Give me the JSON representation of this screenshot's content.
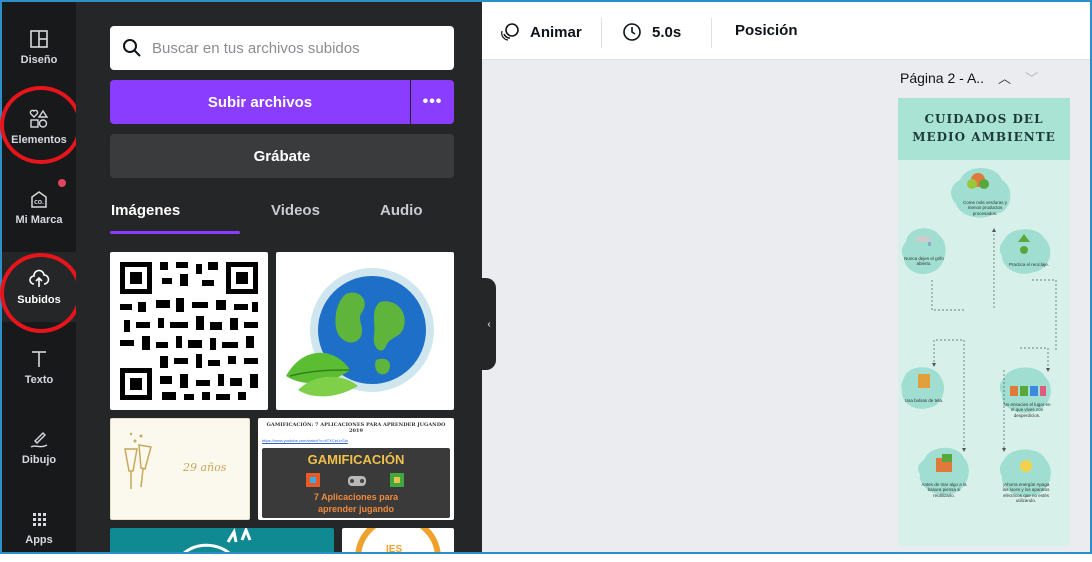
{
  "rail": {
    "items": [
      {
        "label": "Diseño",
        "icon": "layout-icon"
      },
      {
        "label": "Elementos",
        "icon": "shapes-icon"
      },
      {
        "label": "Mi Marca",
        "icon": "brand-kit-icon"
      },
      {
        "label": "Subidos",
        "icon": "upload-cloud-icon"
      },
      {
        "label": "Texto",
        "icon": "text-icon"
      },
      {
        "label": "Dibujo",
        "icon": "draw-icon"
      },
      {
        "label": "Apps",
        "icon": "apps-grid-icon"
      }
    ]
  },
  "panel": {
    "search_placeholder": "Buscar en tus archivos subidos",
    "upload_label": "Subir archivos",
    "more_label": "•••",
    "record_label": "Grábate",
    "tabs": [
      "Imágenes",
      "Videos",
      "Audio"
    ],
    "thumbs": {
      "card_years": "29 años",
      "gamif_header": "GAMIFICACIÓN: 7 APLICACIONES PARA APRENDER JUGANDO 2019",
      "gamif_link": "https://www.youtube.com/watch?v=hTXCeLbGla",
      "gamif_title": "GAMIFICACIÓN",
      "gamif_sub1": "7 Aplicaciones para",
      "gamif_sub2": "aprender jugando",
      "partial_right": "IES"
    }
  },
  "toolbar": {
    "animate_label": "Animar",
    "duration_label": "5.0s",
    "position_label": "Posición"
  },
  "canvas": {
    "page_label": "Página 2 - A..",
    "poster": {
      "title_line1": "CUIDADOS DEL",
      "title_line2": "MEDIO AMBIENTE",
      "tips": [
        "Come más verduras y menos productos procesados.",
        "Nunca dejes el grifo abierto.",
        "Practica el reciclaje.",
        "Usa bolsas de tela.",
        "No ensucies el lugar en el que vives con desperdicios.",
        "Antes de tirar algo a la basura piensa si reutilizarlo.",
        "¡Ahorra energía! Apaga las luces y los aparatos eléctricos que no estés utilizando."
      ]
    }
  },
  "colors": {
    "accent": "#8b3dff",
    "rail_bg": "#18191b",
    "panel_bg": "#252627",
    "annotation_red": "#e8141c",
    "poster_bg": "#d7f1ea",
    "poster_header": "#a9e3d3"
  }
}
